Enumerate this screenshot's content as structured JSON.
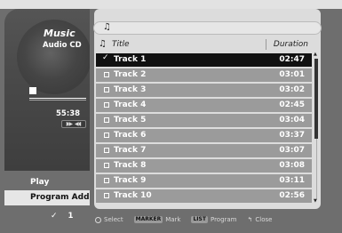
{
  "player": {
    "title": "Music",
    "source": "Audio CD",
    "elapsed": "55:38",
    "audio_channel": "◗▶ ◀◖"
  },
  "side_menu": {
    "play_label": "Play",
    "program_add_label": "Program Add",
    "marked_count": "1"
  },
  "list": {
    "columns": {
      "title": "Title",
      "duration": "Duration"
    },
    "tracks": [
      {
        "name": "Track 1",
        "duration": "02:47"
      },
      {
        "name": "Track 2",
        "duration": "03:01"
      },
      {
        "name": "Track 3",
        "duration": "03:02"
      },
      {
        "name": "Track 4",
        "duration": "02:45"
      },
      {
        "name": "Track 5",
        "duration": "03:04"
      },
      {
        "name": "Track 6",
        "duration": "03:37"
      },
      {
        "name": "Track 7",
        "duration": "03:07"
      },
      {
        "name": "Track 8",
        "duration": "03:08"
      },
      {
        "name": "Track 9",
        "duration": "03:11"
      },
      {
        "name": "Track 10",
        "duration": "02:56"
      }
    ],
    "current_index": 0
  },
  "footer": {
    "select_label": "Select",
    "marker_key": "MARKER",
    "mark_label": "Mark",
    "list_key": "LIST",
    "program_label": "Program",
    "close_label": "Close"
  },
  "icons": {
    "note": "music-note-icon",
    "check": "check-mark-icon",
    "enter": "enter-circle-icon",
    "return": "return-arrow-icon"
  }
}
